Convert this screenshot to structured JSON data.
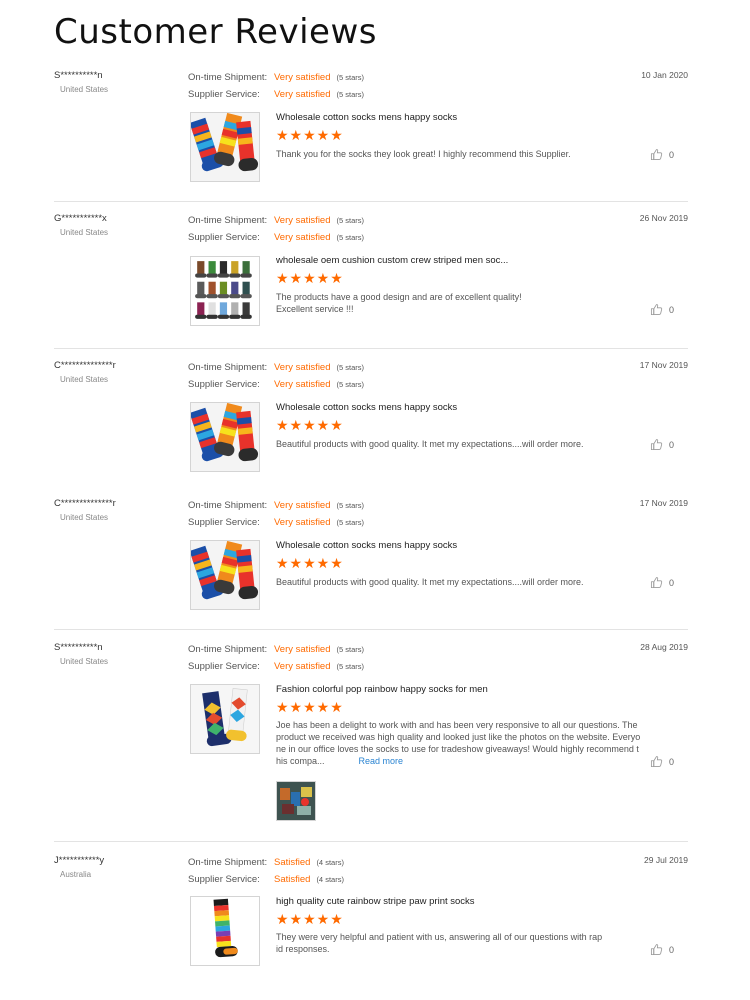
{
  "page": {
    "title": "Customer Reviews"
  },
  "labels": {
    "shipment": "On-time Shipment:",
    "service": "Supplier Service:",
    "read_more": "Read more"
  },
  "colors": {
    "accent": "#ff6a00",
    "link": "#2a84d2",
    "divider": "#e3e3e3"
  },
  "icons": {
    "like": "thumbs-up-icon",
    "star": "star-icon"
  },
  "reviews": [
    {
      "user": "S**********n",
      "country": "United States",
      "date": "10 Jan 2020",
      "shipment": "Very satisfied",
      "shipment_stars": "(5 stars)",
      "service": "Very satisfied",
      "service_stars": "(5 stars)",
      "product": "Wholesale cotton socks mens happy socks",
      "rating": 5,
      "rating_text": "★★★★★",
      "comment": "Thank you for the socks they look great! I highly recommend this Supplier.",
      "likes": "0"
    },
    {
      "user": "G***********x",
      "country": "United States",
      "date": "26 Nov 2019",
      "shipment": "Very satisfied",
      "shipment_stars": "(5 stars)",
      "service": "Very satisfied",
      "service_stars": "(5 stars)",
      "product": "wholesale oem cushion custom crew striped men soc...",
      "rating": 5,
      "rating_text": "★★★★★",
      "comment_lines": [
        "The products have a good design and are of excellent quality!",
        "Excellent service !!!"
      ],
      "likes": "0"
    },
    {
      "user": "C**************r",
      "country": "United States",
      "date": "17 Nov 2019",
      "shipment": "Very satisfied",
      "shipment_stars": "(5 stars)",
      "service": "Very satisfied",
      "service_stars": "(5 stars)",
      "product": "Wholesale cotton socks mens happy socks",
      "rating": 5,
      "rating_text": "★★★★★",
      "comment": "Beautiful products with good quality. It met my expectations....will order more.",
      "likes": "0"
    },
    {
      "user": "C**************r",
      "country": "United States",
      "date": "17 Nov 2019",
      "shipment": "Very satisfied",
      "shipment_stars": "(5 stars)",
      "service": "Very satisfied",
      "service_stars": "(5 stars)",
      "product": "Wholesale cotton socks mens happy socks",
      "rating": 5,
      "rating_text": "★★★★★",
      "comment": "Beautiful products with good quality. It met my expectations....will order more.",
      "likes": "0"
    },
    {
      "user": "S**********n",
      "country": "United States",
      "date": "28 Aug 2019",
      "shipment": "Very satisfied",
      "shipment_stars": "(5 stars)",
      "service": "Very satisfied",
      "service_stars": "(5 stars)",
      "product": "Fashion colorful pop rainbow happy socks for men",
      "rating": 5,
      "rating_text": "★★★★★",
      "comment_lines": [
        "Joe has been a delight to work with and has been very responsive to all our questions. The",
        "product we received was high quality and looked just like the photos on the website. Everyo",
        "ne in our office loves the socks to use for tradeshow giveaways! Would highly recommend t",
        "his compa..."
      ],
      "likes": "0"
    },
    {
      "user": "J***********y",
      "country": "Australia",
      "date": "29 Jul 2019",
      "shipment": "Satisfied",
      "shipment_stars": "(4 stars)",
      "service": "Satisfied",
      "service_stars": "(4 stars)",
      "product": "high quality cute rainbow stripe paw print socks",
      "rating": 5,
      "rating_text": "★★★★★",
      "comment_lines": [
        "They were very helpful and patient with us, answering all of our questions with rap",
        "id responses."
      ],
      "likes": "0"
    }
  ]
}
